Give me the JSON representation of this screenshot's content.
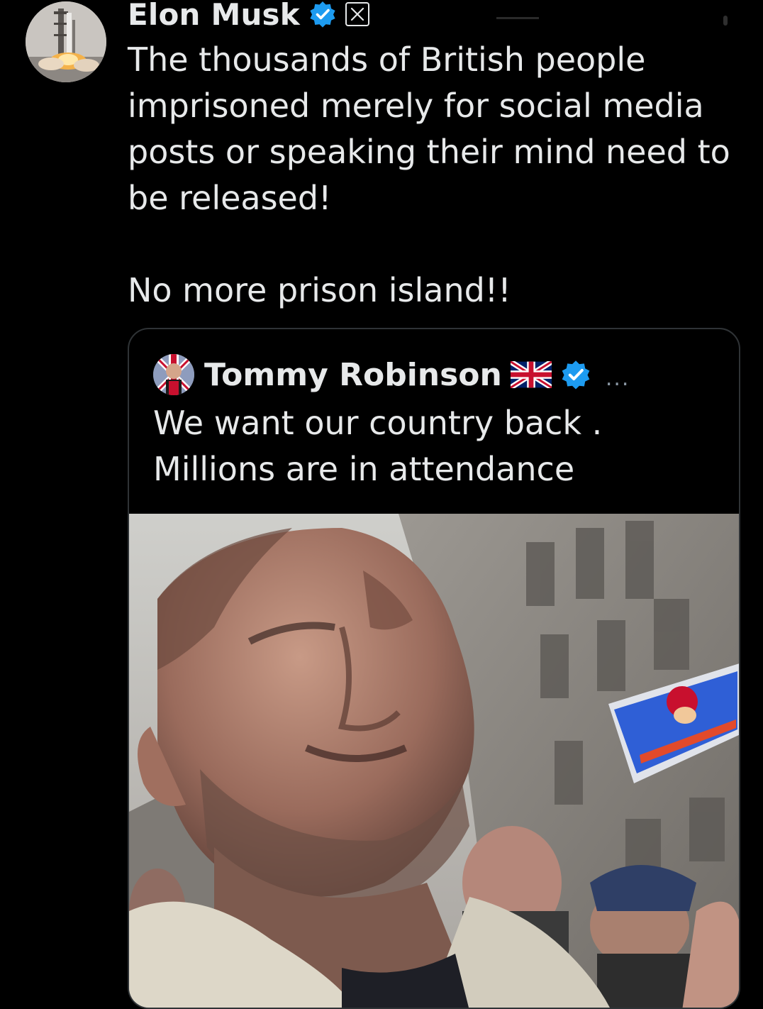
{
  "tweet": {
    "author": {
      "display_name": "Elon Musk",
      "verified_icon": "verified-badge-icon",
      "affiliation_icon": "x-logo-icon"
    },
    "text": "The thousands of British people imprisoned merely for social media posts or speaking their mind need to be released!\n\nNo more prison island!!"
  },
  "quoted": {
    "author": {
      "display_name": "Tommy Robinson",
      "flag_icon": "uk-flag-icon",
      "verified_icon": "verified-badge-icon",
      "more_label": "..."
    },
    "text": "We want our country back .\nMillions are in attendance",
    "media": {
      "kind": "video-frame"
    }
  },
  "colors": {
    "background": "#000000",
    "text": "#e7e9ea",
    "verified_blue": "#1d9bf0",
    "border": "#2f3336",
    "muted": "#8b98a5"
  }
}
